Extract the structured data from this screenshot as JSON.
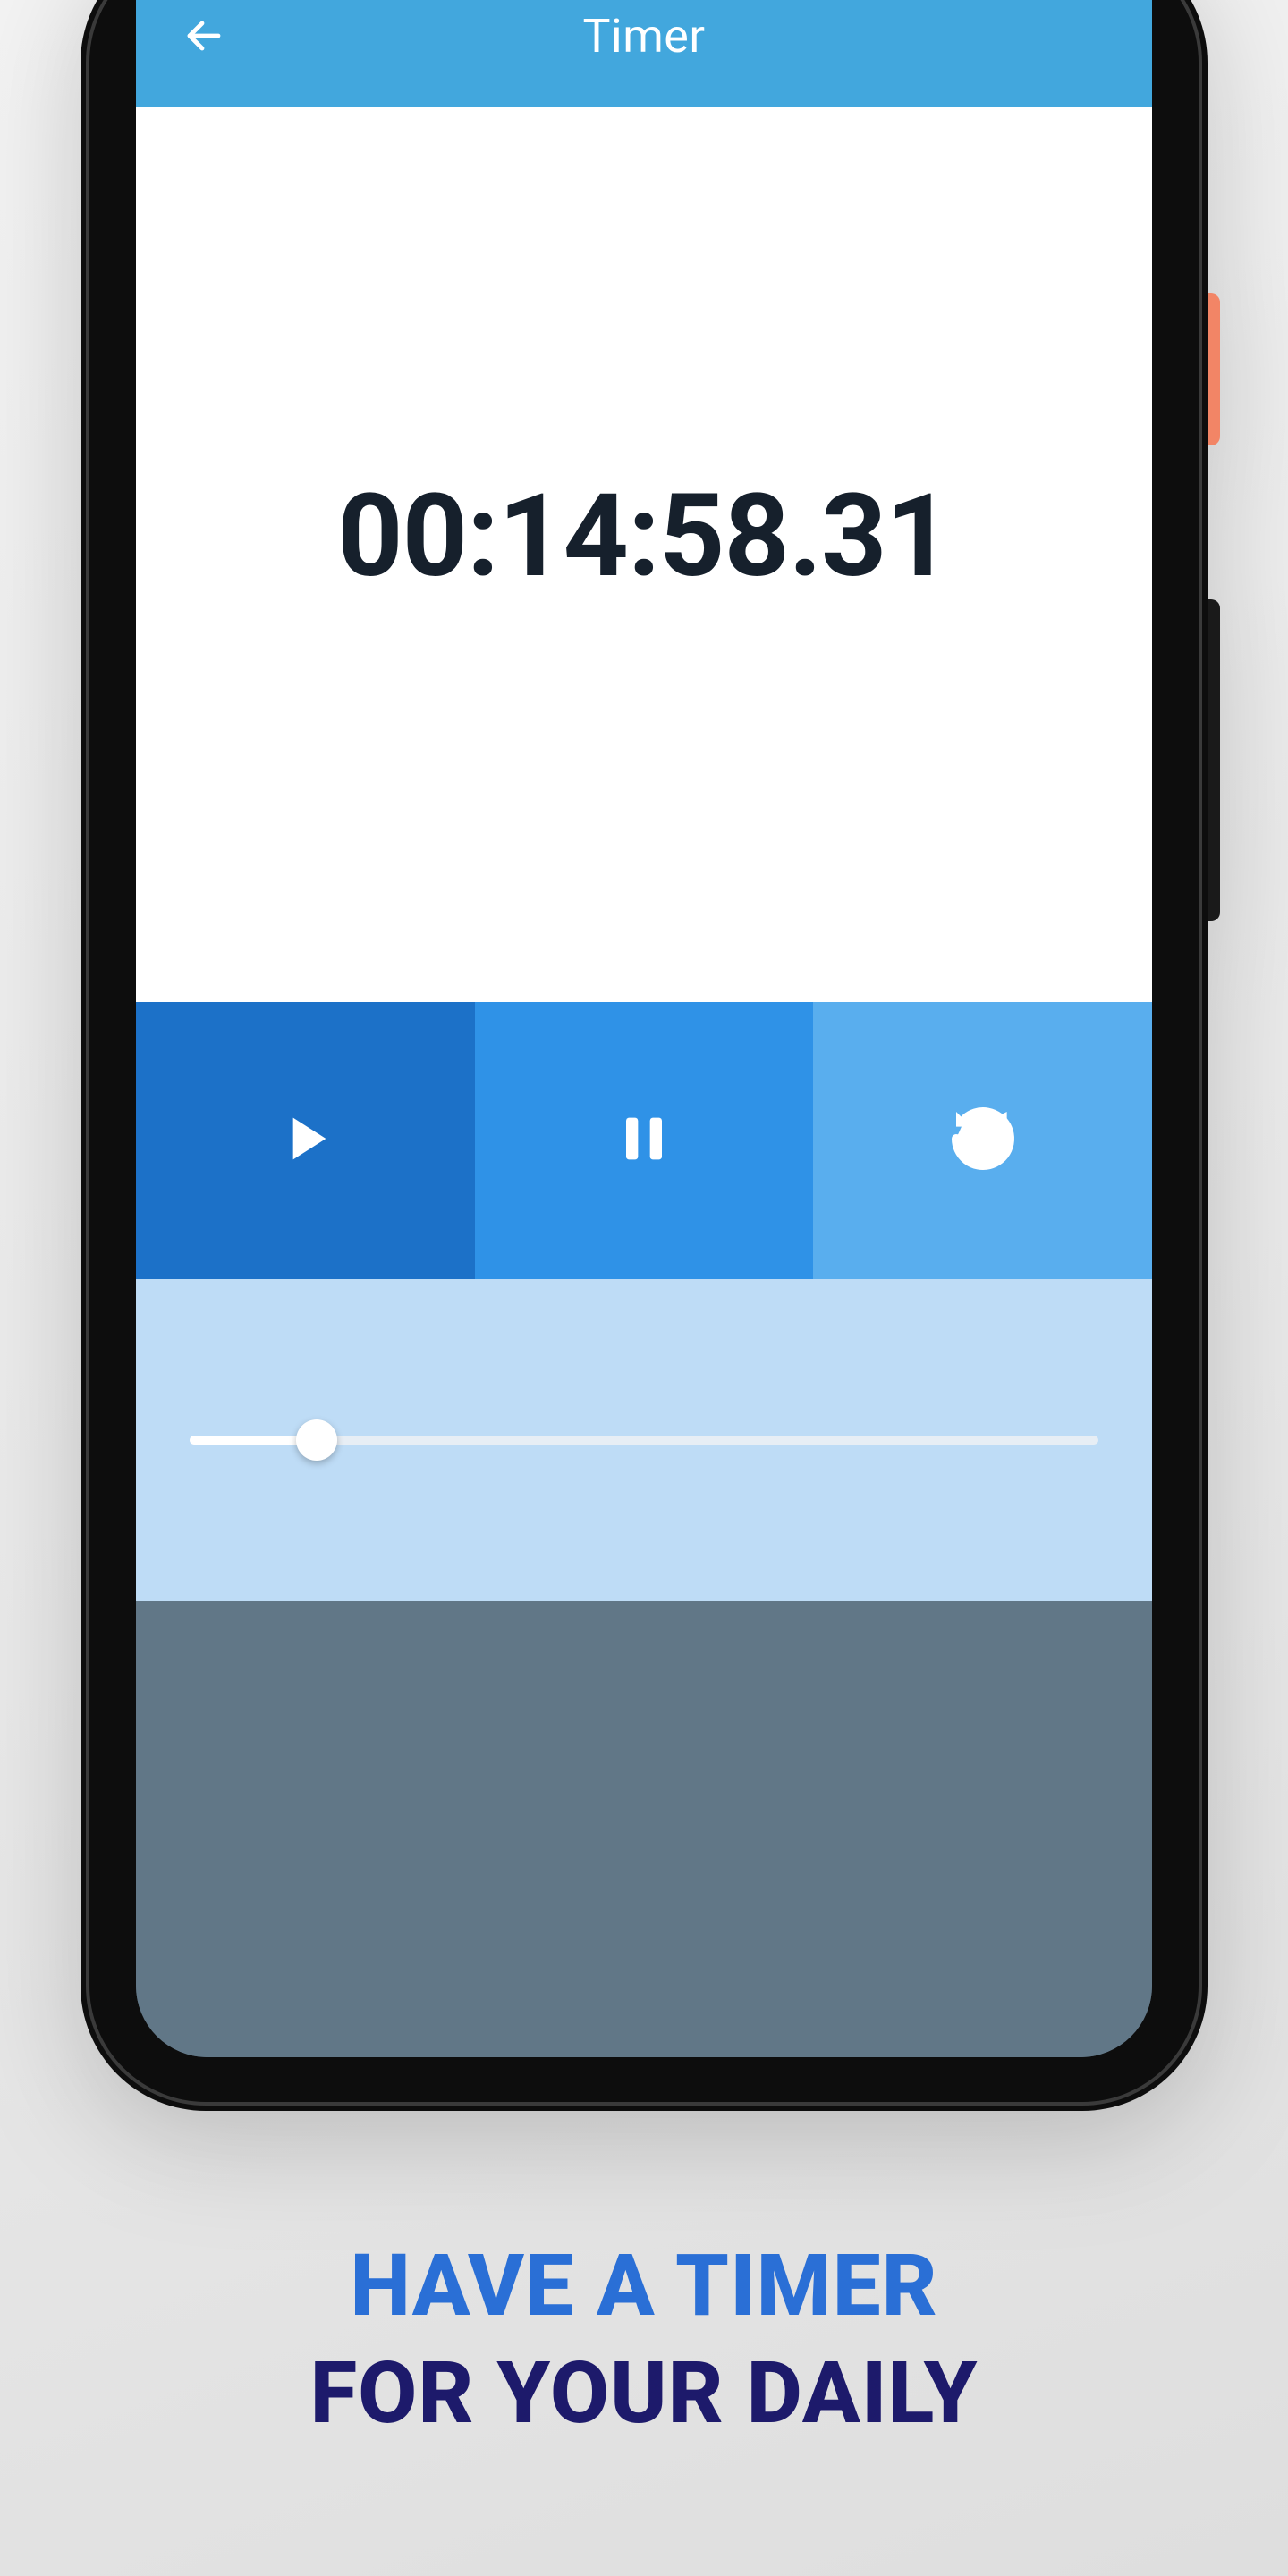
{
  "header": {
    "title": "Timer"
  },
  "timer": {
    "display": "00:14:58.31"
  },
  "controls": {
    "play": "play",
    "pause": "pause",
    "reset": "reset"
  },
  "slider": {
    "percent": 14
  },
  "caption": {
    "line1": "HAVE A TIMER",
    "line2": "FOR YOUR DAILY"
  },
  "colors": {
    "appbar": "#42a7dd",
    "play": "#1c71c8",
    "pause": "#2f92e7",
    "reset": "#59aeee",
    "sliderPanel": "#bedcf6",
    "captionBlue": "#2a6fd6",
    "captionNavy": "#1d1a6b"
  }
}
